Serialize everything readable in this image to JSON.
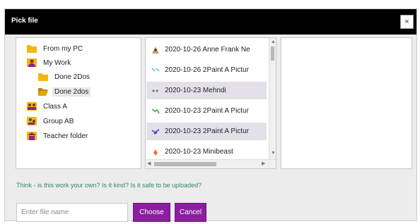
{
  "dialog": {
    "title": "Pick file",
    "close_label": "×"
  },
  "tree": {
    "items": [
      {
        "label": "From my PC",
        "icon": "folder-icon"
      },
      {
        "label": "My Work",
        "icon": "user-icon"
      },
      {
        "label": "Done 2Dos",
        "icon": "folder-icon"
      },
      {
        "label": "Done 2dos",
        "icon": "folder-open-icon",
        "selected": true
      },
      {
        "label": "Class A",
        "icon": "class-icon"
      },
      {
        "label": "Group AB",
        "icon": "group-icon"
      },
      {
        "label": "Teacher folder",
        "icon": "teacher-icon"
      }
    ]
  },
  "files": {
    "items": [
      {
        "label": "2020-10-26 Anne Frank Ne",
        "icon": "drawing-thumbnail-icon"
      },
      {
        "label": "2020-10-26 2Paint A Pictur",
        "icon": "paint-thumbnail-icon"
      },
      {
        "label": "2020-10-23 Mehndi",
        "icon": "paint-thumbnail-icon"
      },
      {
        "label": "2020-10-23 2Paint A Pictur",
        "icon": "paint-thumbnail-icon"
      },
      {
        "label": "2020-10-23 2Paint A Pictur",
        "icon": "paint-thumbnail-icon"
      },
      {
        "label": "2020-10-23 Minibeast",
        "icon": "paint-thumbnail-icon"
      }
    ]
  },
  "hint": "Think - is this work your own? Is it kind? Is it safe to be uploaded?",
  "footer": {
    "filename_placeholder": "Enter file name",
    "filename_value": "",
    "choose_label": "Choose",
    "cancel_label": "Cancel"
  },
  "colors": {
    "titlebar": "#000000",
    "button": "#8b1fa0",
    "hint": "#2e8b57",
    "highlight_row": "#e3e0ea",
    "folder": "#f2b70a"
  }
}
